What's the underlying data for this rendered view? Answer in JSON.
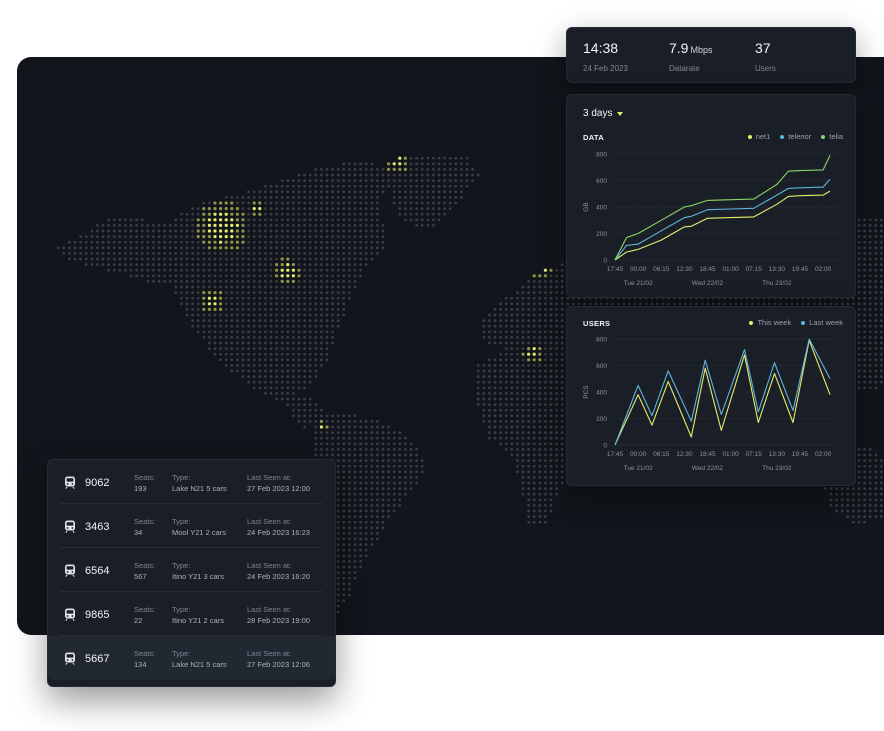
{
  "stats": [
    {
      "value": "14:38",
      "unit": "",
      "label": "24 Feb 2023"
    },
    {
      "value": "7.9",
      "unit": "Mbps",
      "label": "Datarate"
    },
    {
      "value": "37",
      "unit": "",
      "label": "Users"
    }
  ],
  "range": {
    "label": "3 days",
    "icon": "caret-down-icon"
  },
  "colors": {
    "yellow": "#e6ec6b",
    "blue": "#5fb3dc",
    "green": "#8cd36a",
    "accent": "#e0e86a"
  },
  "chart_data": [
    {
      "type": "line",
      "title": "DATA",
      "ylabel": "GB",
      "ylim": [
        0,
        800
      ],
      "yticks": [
        0,
        200,
        400,
        600,
        800
      ],
      "xticks": [
        "17:45",
        "00:00",
        "06:15",
        "12:30",
        "18:45",
        "01:00",
        "07:15",
        "13:30",
        "19:45",
        "02:00"
      ],
      "day_labels": [
        "Tue 21/02",
        "Wed 22/02",
        "Thu 23/02"
      ],
      "grid": true,
      "legend_position": "top-right",
      "x": [
        0,
        0.5,
        1,
        2,
        3,
        3.3,
        4,
        5,
        6,
        7,
        7.5,
        8,
        9,
        9.3
      ],
      "series": [
        {
          "name": "net1",
          "color": "#e6ec6b",
          "values": [
            0,
            60,
            80,
            150,
            250,
            255,
            315,
            320,
            325,
            420,
            480,
            485,
            490,
            520
          ]
        },
        {
          "name": "telenor",
          "color": "#5fb3dc",
          "values": [
            0,
            110,
            120,
            220,
            320,
            330,
            380,
            385,
            390,
            490,
            540,
            545,
            550,
            610
          ]
        },
        {
          "name": "telia",
          "color": "#8cd36a",
          "values": [
            0,
            170,
            200,
            300,
            400,
            410,
            450,
            455,
            460,
            570,
            670,
            675,
            680,
            790
          ]
        }
      ]
    },
    {
      "type": "line",
      "title": "USERS",
      "ylabel": "PCS",
      "ylim": [
        0,
        800
      ],
      "yticks": [
        0,
        200,
        400,
        600,
        800
      ],
      "xticks": [
        "17:45",
        "00:00",
        "06:15",
        "12:30",
        "18:45",
        "01:00",
        "07:15",
        "13:30",
        "19:45",
        "02:00"
      ],
      "day_labels": [
        "Tue 21/02",
        "Wed 22/02",
        "Thu 23/02"
      ],
      "grid": true,
      "legend_position": "top-right",
      "x": [
        0,
        1,
        1.6,
        2.3,
        3.3,
        3.9,
        4.6,
        5.6,
        6.2,
        6.9,
        7.7,
        8.4,
        9.3
      ],
      "series": [
        {
          "name": "This week",
          "color": "#e6ec6b",
          "values": [
            0,
            380,
            150,
            480,
            60,
            580,
            110,
            680,
            170,
            540,
            170,
            790,
            380
          ]
        },
        {
          "name": "Last week",
          "color": "#5fb3dc",
          "values": [
            0,
            450,
            220,
            560,
            180,
            640,
            230,
            720,
            250,
            620,
            260,
            800,
            500
          ]
        }
      ]
    }
  ],
  "vehicles": {
    "labels": {
      "seats": "Seats:",
      "type": "Type:",
      "last_seen": "Last Seen at:"
    },
    "icon": "train-icon",
    "rows": [
      {
        "id": "9062",
        "seats": "193",
        "type": "Lake N21 5 cars",
        "last_seen": "27 Feb 2023 12:00"
      },
      {
        "id": "3463",
        "seats": "34",
        "type": "Mool Y21 2 cars",
        "last_seen": "24 Feb 2023 16:23"
      },
      {
        "id": "6564",
        "seats": "567",
        "type": "Itino Y21 3 cars",
        "last_seen": "24 Feb 2023 16:20"
      },
      {
        "id": "9865",
        "seats": "22",
        "type": "Itino Y21 2 cars",
        "last_seen": "28 Feb 2023 19:00"
      },
      {
        "id": "5667",
        "seats": "134",
        "type": "Lake N21 5 cars",
        "last_seen": "27 Feb 2023 12:06"
      }
    ]
  },
  "map": {
    "style": "dotted-world-map",
    "hotspots_color": "#e6ec6b"
  }
}
